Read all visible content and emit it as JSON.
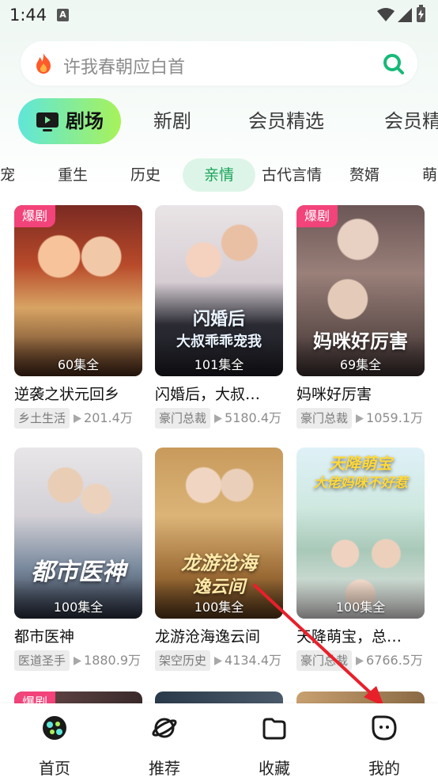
{
  "status_bar": {
    "time": "1:44",
    "notification": "A"
  },
  "search": {
    "placeholder": "许我春朝应白首"
  },
  "top_tabs": [
    {
      "label": "剧场",
      "active": true,
      "icon": "tv-icon"
    },
    {
      "label": "新剧"
    },
    {
      "label": "会员精选"
    },
    {
      "label": "会员精"
    }
  ],
  "sub_categories": [
    {
      "label": "宠"
    },
    {
      "label": "重生"
    },
    {
      "label": "历史"
    },
    {
      "label": "亲情",
      "active": true
    },
    {
      "label": "古代言情"
    },
    {
      "label": "赘婿"
    },
    {
      "label": "萌"
    }
  ],
  "dramas": [
    {
      "title": "逆袭之状元回乡",
      "episodes": "60集全",
      "badge": "爆剧",
      "tag": "乡土生活",
      "views": "201.4万",
      "poster_text": ""
    },
    {
      "title": "闪婚后，大叔…",
      "episodes": "101集全",
      "badge": "",
      "tag": "豪门总裁",
      "views": "5180.4万",
      "poster_text": "闪婚后 大叔乖乖宠我"
    },
    {
      "title": "妈咪好厉害",
      "episodes": "69集全",
      "badge": "爆剧",
      "tag": "豪门总裁",
      "views": "1059.1万",
      "poster_text": "妈咪好厉害"
    },
    {
      "title": "都市医神",
      "episodes": "100集全",
      "badge": "",
      "tag": "医道圣手",
      "views": "1880.9万",
      "poster_text": "都市医神"
    },
    {
      "title": "龙游沧海逸云间",
      "episodes": "100集全",
      "badge": "",
      "tag": "架空历史",
      "views": "4134.4万",
      "poster_text": "龙游沧海 逸云间"
    },
    {
      "title": "天降萌宝，总…",
      "episodes": "100集全",
      "badge": "",
      "tag": "豪门总裁",
      "views": "6766.5万",
      "poster_text": "天降萌宝 大佬妈咪不好惹"
    },
    {
      "title": "",
      "episodes": "",
      "badge": "爆剧",
      "tag": "",
      "views": "",
      "poster_text": ""
    }
  ],
  "bottom_nav": [
    {
      "label": "首页",
      "icon": "home-icon",
      "active": true
    },
    {
      "label": "推荐",
      "icon": "planet-icon"
    },
    {
      "label": "收藏",
      "icon": "folder-icon"
    },
    {
      "label": "我的",
      "icon": "profile-icon"
    }
  ],
  "colors": {
    "accent_green": "#1aa35a",
    "tab_gradient_start": "#5fe6da",
    "tab_gradient_end": "#a8f25a",
    "hot_badge": "#f2437a",
    "annotation_arrow": "#e8202a"
  }
}
